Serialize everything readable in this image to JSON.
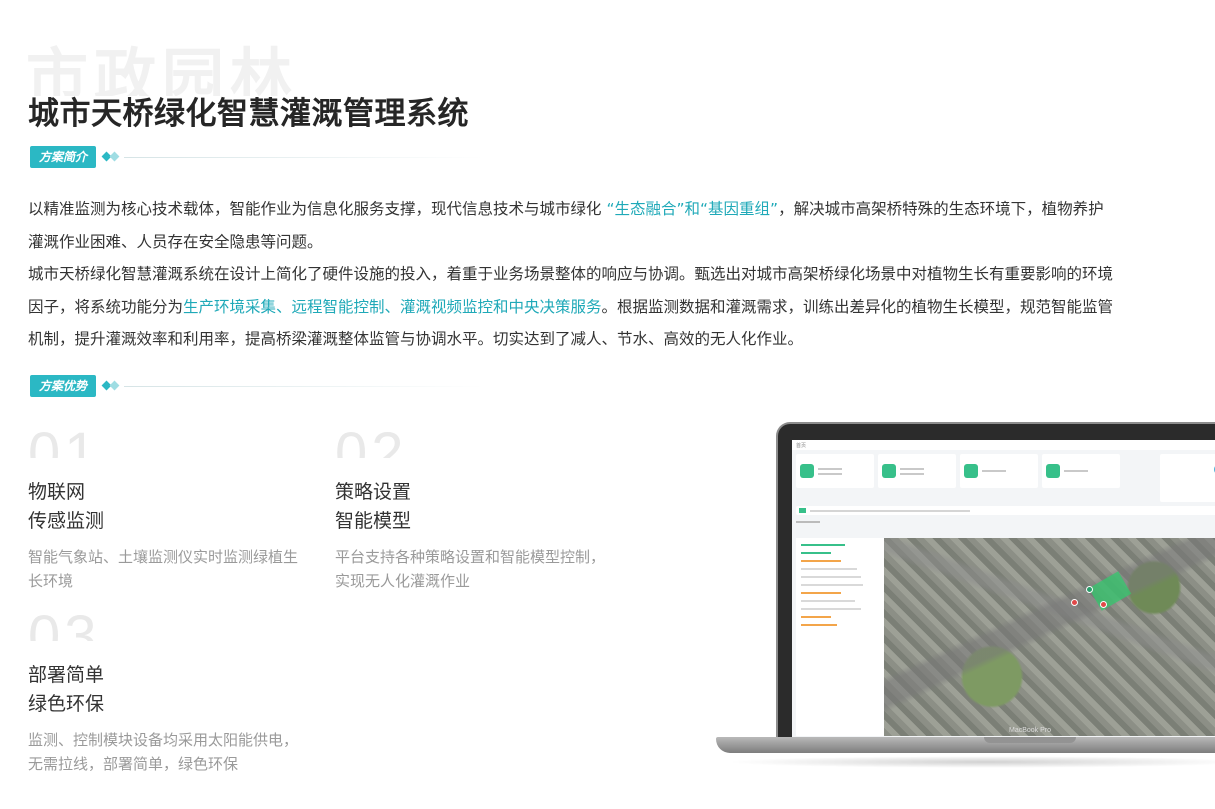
{
  "header": {
    "watermark": "市政园林",
    "title": "城市天桥绿化智慧灌溉管理系统"
  },
  "sections": {
    "intro_tag": "方案简介",
    "advantage_tag": "方案优势"
  },
  "intro": {
    "p1_before": "以精准监测为核心技术载体，智能作业为信息化服务支撑，现代信息技术与城市绿化 ",
    "p1_highlight": "“生态融合”和“基因重组”",
    "p1_after": "，解决城市高架桥特殊的生态环境下，植物养护灌溉作业困难、人员存在安全隐患等问题。",
    "p2_before": "城市天桥绿化智慧灌溉系统在设计上简化了硬件设施的投入，着重于业务场景整体的响应与协调。甄选出对城市高架桥绿化场景中对植物生长有重要影响的环境因子，将系统功能分为",
    "p2_highlight": "生产环境采集、远程智能控制、灌溉视频监控和中央决策服务",
    "p2_after": "。根据监测数据和灌溉需求，训练出差异化的植物生长模型，规范智能监管机制，提升灌溉效率和利用率，提高桥梁灌溉整体监管与协调水平。切实达到了减人、节水、高效的无人化作业。"
  },
  "advantages": [
    {
      "num": "01",
      "title_line1": "物联网",
      "title_line2": "传感监测",
      "desc": "智能气象站、土壤监测仪实时监测绿植生长环境"
    },
    {
      "num": "02",
      "title_line1": "策略设置",
      "title_line2": "智能模型",
      "desc": "平台支持各种策略设置和智能模型控制，实现无人化灌溉作业"
    },
    {
      "num": "03",
      "title_line1": "部署简单",
      "title_line2": "绿色环保",
      "desc": "监测、控制模块设备均采用太阳能供电，无需拉线，部署简单，绿色环保"
    }
  ],
  "laptop": {
    "label": "MacBook Pro",
    "screen_title": "首页",
    "card_icons": [
      "monitor-icon",
      "control-icon",
      "log-icon",
      "video-icon"
    ],
    "accent": "#37c08a",
    "weather_icon": "cloud-icon"
  },
  "colors": {
    "accent": "#2bb8c4",
    "highlight": "#1fa9b8",
    "title": "#262626",
    "muted": "#9a9a9a"
  }
}
